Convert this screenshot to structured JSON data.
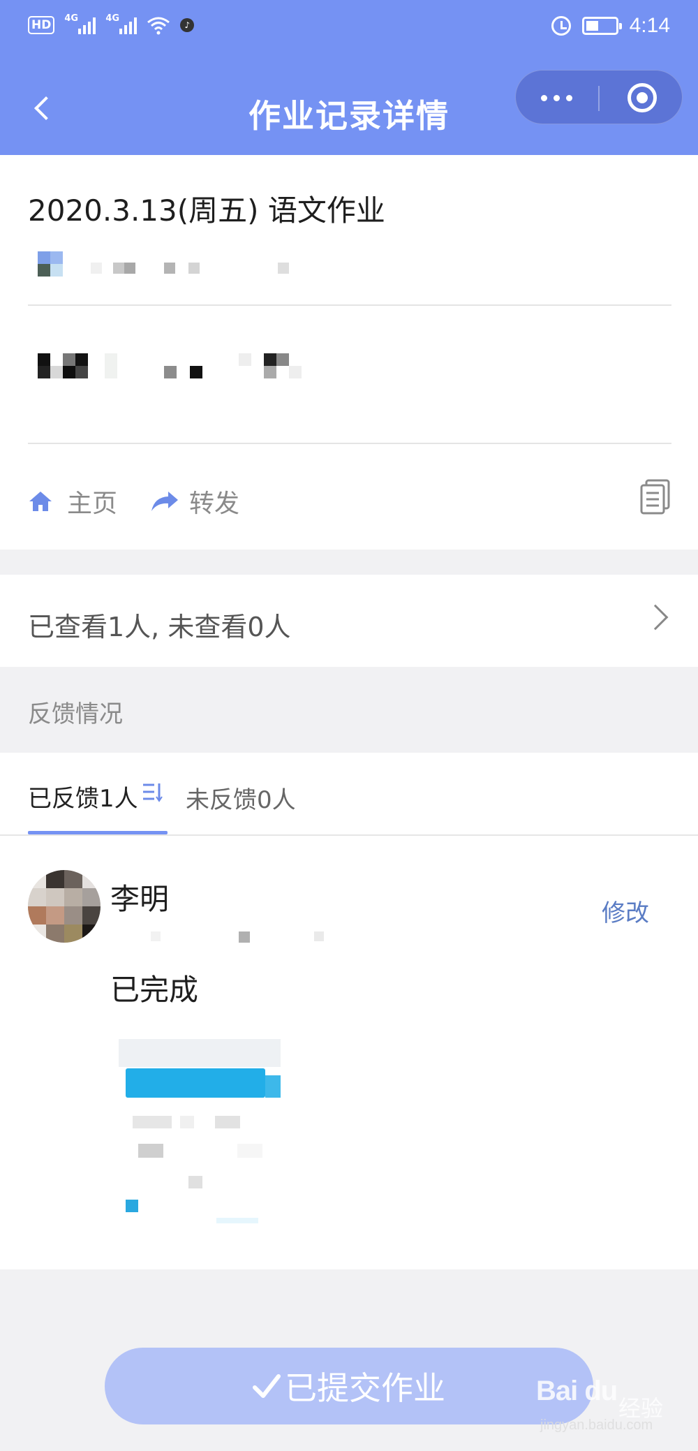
{
  "status_bar": {
    "hd": "HD",
    "net1": "4G",
    "net2": "4G",
    "time": "4:14"
  },
  "header": {
    "title": "作业记录详情"
  },
  "homework": {
    "title": "2020.3.13(周五) 语文作业"
  },
  "actions": {
    "home_label": "主页",
    "forward_label": "转发"
  },
  "viewed": {
    "text": "已查看1人, 未查看0人"
  },
  "feedback": {
    "heading": "反馈情况",
    "tab_submitted": "已反馈1人",
    "tab_pending": "未反馈0人"
  },
  "entry": {
    "name": "李明",
    "edit_label": "修改",
    "status": "已完成"
  },
  "submit": {
    "label": "已提交作业"
  },
  "watermark": {
    "logo": "Bai du",
    "jingyan": "经验",
    "url": "jingyan.baidu.com"
  },
  "colors": {
    "header_bg": "#7592f3",
    "accent": "#7592f3",
    "link": "#5a7cc4",
    "button_bg": "#b3c2f7"
  },
  "icons": [
    "back-icon",
    "more-icon",
    "close-target-icon",
    "home-icon",
    "forward-icon",
    "copy-icon",
    "chevron-right-icon",
    "sort-icon",
    "check-icon"
  ]
}
